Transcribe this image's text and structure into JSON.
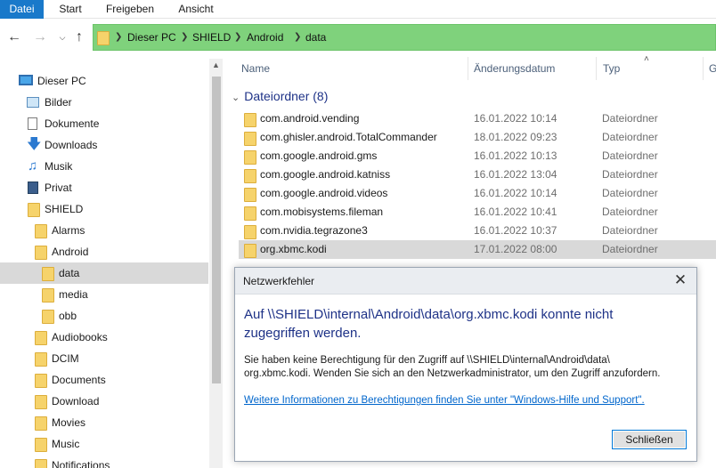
{
  "ribbon": {
    "tabs": [
      "Datei",
      "Start",
      "Freigeben",
      "Ansicht"
    ]
  },
  "address": {
    "crumbs": [
      "Dieser PC",
      "SHIELD",
      "Android",
      "data"
    ]
  },
  "sidebar": {
    "items": [
      {
        "label": "Dieser PC",
        "icon": "monitor-icon"
      },
      {
        "label": "Bilder",
        "icon": "pictures-icon"
      },
      {
        "label": "Dokumente",
        "icon": "documents-icon"
      },
      {
        "label": "Downloads",
        "icon": "download-arrow-icon"
      },
      {
        "label": "Musik",
        "icon": "music-note-icon"
      },
      {
        "label": "Privat",
        "icon": "private-folder-icon"
      },
      {
        "label": "SHIELD",
        "icon": "folder-icon"
      },
      {
        "label": "Alarms",
        "icon": "folder-icon"
      },
      {
        "label": "Android",
        "icon": "folder-icon"
      },
      {
        "label": "data",
        "icon": "folder-icon"
      },
      {
        "label": "media",
        "icon": "folder-icon"
      },
      {
        "label": "obb",
        "icon": "folder-icon"
      },
      {
        "label": "Audiobooks",
        "icon": "folder-icon"
      },
      {
        "label": "DCIM",
        "icon": "folder-icon"
      },
      {
        "label": "Documents",
        "icon": "folder-icon"
      },
      {
        "label": "Download",
        "icon": "folder-icon"
      },
      {
        "label": "Movies",
        "icon": "folder-icon"
      },
      {
        "label": "Music",
        "icon": "folder-icon"
      },
      {
        "label": "Notifications",
        "icon": "folder-icon"
      }
    ]
  },
  "columns": {
    "name": "Name",
    "date": "Änderungsdatum",
    "type": "Typ",
    "size": "G"
  },
  "group": {
    "label": "Dateiordner (8)"
  },
  "files": [
    {
      "name": "com.android.vending",
      "date": "16.01.2022 10:14",
      "type": "Dateiordner"
    },
    {
      "name": "com.ghisler.android.TotalCommander",
      "date": "18.01.2022 09:23",
      "type": "Dateiordner"
    },
    {
      "name": "com.google.android.gms",
      "date": "16.01.2022 10:13",
      "type": "Dateiordner"
    },
    {
      "name": "com.google.android.katniss",
      "date": "16.01.2022 13:04",
      "type": "Dateiordner"
    },
    {
      "name": "com.google.android.videos",
      "date": "16.01.2022 10:14",
      "type": "Dateiordner"
    },
    {
      "name": "com.mobisystems.fileman",
      "date": "16.01.2022 10:41",
      "type": "Dateiordner"
    },
    {
      "name": "com.nvidia.tegrazone3",
      "date": "16.01.2022 10:37",
      "type": "Dateiordner"
    },
    {
      "name": "org.xbmc.kodi",
      "date": "17.01.2022 08:00",
      "type": "Dateiordner"
    }
  ],
  "dialog": {
    "title": "Netzwerkfehler",
    "heading": "Auf \\\\SHIELD\\internal\\Android\\data\\org.xbmc.kodi konnte nicht zugegriffen werden.",
    "body_line1": "Sie haben keine Berechtigung für den Zugriff auf \\\\SHIELD\\internal\\Android\\data\\",
    "body_line2": "org.xbmc.kodi. Wenden Sie sich an den Netzwerkadministrator, um den Zugriff anzufordern.",
    "link": "Weitere Informationen zu Berechtigungen finden Sie unter \"Windows-Hilfe und Support\".",
    "button": "Schließen"
  },
  "colors": {
    "accent": "#1979ca",
    "address_bar": "#7fd27c",
    "heading_blue": "#1e3287",
    "link": "#0066cc"
  }
}
